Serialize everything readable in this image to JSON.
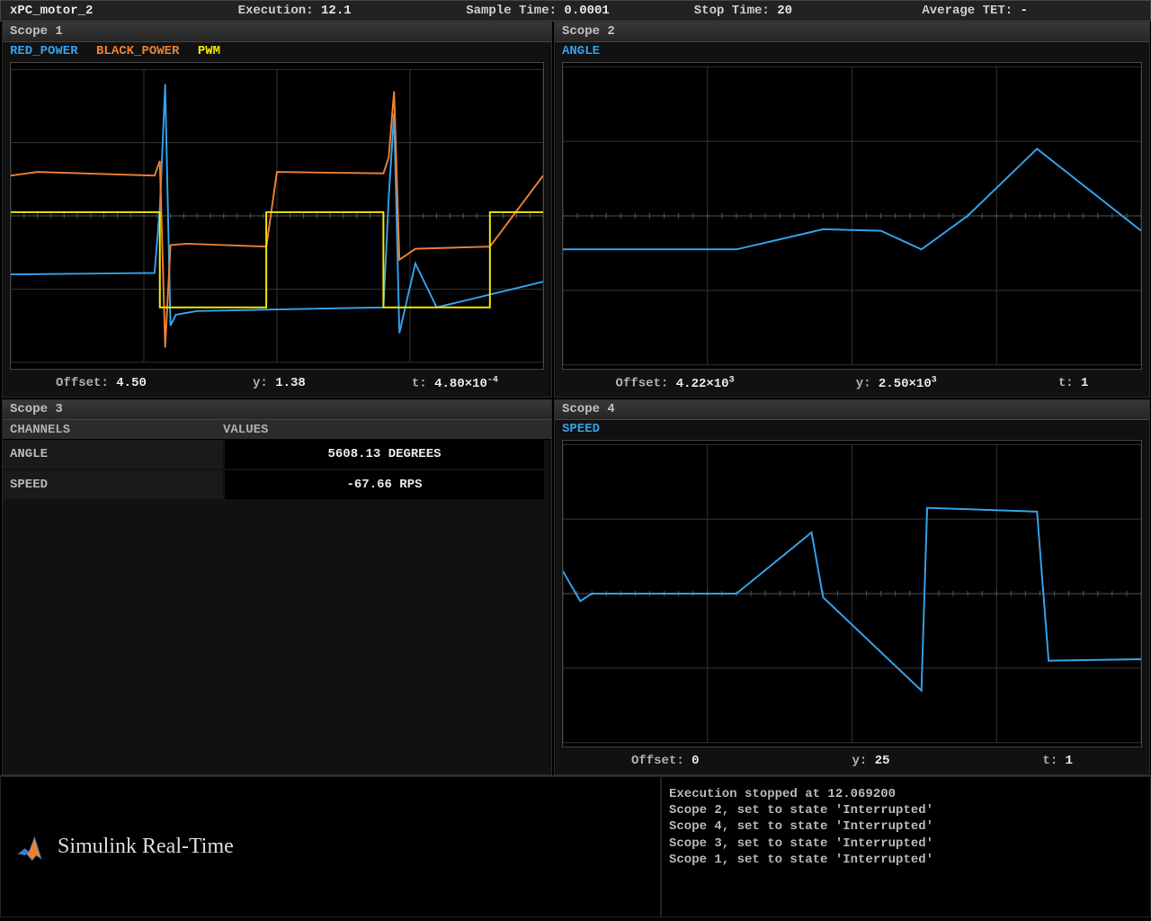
{
  "header": {
    "model_label": "xPC_motor_2",
    "exec_label": "Execution:",
    "exec_val": "12.1",
    "sample_label": "Sample Time:",
    "sample_val": "0.0001",
    "stop_label": "Stop Time:",
    "stop_val": "20",
    "tet_label": "Average TET:",
    "tet_val": "-"
  },
  "scope1": {
    "title": "Scope 1",
    "legend": {
      "a": "RED_POWER",
      "b": "BLACK_POWER",
      "c": "PWM"
    },
    "offset_l": "Offset:",
    "offset_v": "4.50",
    "y_l": "y:",
    "y_v": "1.38",
    "t_l": "t:",
    "t_v_pre": "4.80×10",
    "t_v_exp": "-4"
  },
  "scope2": {
    "title": "Scope 2",
    "legend": {
      "a": "ANGLE"
    },
    "offset_l": "Offset:",
    "offset_v_pre": "4.22×10",
    "offset_v_exp": "3",
    "y_l": "y:",
    "y_v_pre": "2.50×10",
    "y_v_exp": "3",
    "t_l": "t:",
    "t_v": "1"
  },
  "scope3": {
    "title": "Scope 3",
    "head_ch": "CHANNELS",
    "head_val": "VALUES",
    "rows": [
      {
        "ch": "ANGLE",
        "val": "5608.13 DEGREES"
      },
      {
        "ch": "SPEED",
        "val": "-67.66 RPS"
      }
    ]
  },
  "scope4": {
    "title": "Scope 4",
    "legend": {
      "a": "SPEED"
    },
    "offset_l": "Offset:",
    "offset_v": "0",
    "y_l": "y:",
    "y_v": "25",
    "t_l": "t:",
    "t_v": "1"
  },
  "footer": {
    "logo": "Simulink Real-Time",
    "log": [
      "Execution stopped at 12.069200",
      "Scope 2, set to state 'Interrupted'",
      "Scope 4, set to state 'Interrupted'",
      "Scope 3, set to state 'Interrupted'",
      "Scope 1, set to state 'Interrupted'"
    ]
  },
  "chart_data": [
    {
      "scope": "Scope 1",
      "type": "line",
      "x_range_note": "time window ≈ 4.8e-4 s, offset 4.50",
      "y_scale": 1.38,
      "series": [
        {
          "name": "RED_POWER",
          "color": "#33a0e8",
          "x_norm": [
            0,
            0.27,
            0.28,
            0.29,
            0.3,
            0.31,
            0.35,
            0.7,
            0.71,
            0.72,
            0.73,
            0.76,
            0.8,
            1.0
          ],
          "y_norm": [
            -0.8,
            -0.78,
            0.1,
            1.8,
            -1.5,
            -1.35,
            -1.3,
            -1.25,
            0.25,
            1.4,
            -1.6,
            -0.65,
            -1.25,
            -0.9
          ]
        },
        {
          "name": "BLACK_POWER",
          "color": "#e87f33",
          "x_norm": [
            0,
            0.05,
            0.27,
            0.28,
            0.29,
            0.3,
            0.33,
            0.48,
            0.5,
            0.7,
            0.71,
            0.72,
            0.73,
            0.76,
            0.9,
            1.0
          ],
          "y_norm": [
            0.55,
            0.6,
            0.55,
            0.75,
            -1.8,
            -0.4,
            -0.38,
            -0.42,
            0.6,
            0.58,
            0.8,
            1.7,
            -0.6,
            -0.45,
            -0.42,
            0.55
          ]
        },
        {
          "name": "PWM",
          "color": "#f0e800",
          "x_norm": [
            0,
            0.28,
            0.28,
            0.48,
            0.48,
            0.7,
            0.7,
            0.9,
            0.9,
            1.0
          ],
          "y_norm": [
            0.05,
            0.05,
            -1.25,
            -1.25,
            0.05,
            0.05,
            -1.25,
            -1.25,
            0.05,
            0.05
          ]
        }
      ]
    },
    {
      "scope": "Scope 2",
      "type": "line",
      "offset": 4220,
      "y_scale": 2500,
      "t_scale": 1,
      "series": [
        {
          "name": "ANGLE",
          "color": "#33a0e8",
          "x_norm": [
            0,
            0.3,
            0.45,
            0.55,
            0.62,
            0.7,
            0.82,
            1.0
          ],
          "y_norm": [
            -0.45,
            -0.45,
            -0.18,
            -0.2,
            -0.45,
            0.0,
            0.9,
            -0.2
          ]
        }
      ]
    },
    {
      "scope": "Scope 4",
      "type": "line",
      "offset": 0,
      "y_scale": 25,
      "t_scale": 1,
      "series": [
        {
          "name": "SPEED",
          "color": "#33a0e8",
          "x_norm": [
            0,
            0.03,
            0.05,
            0.3,
            0.43,
            0.45,
            0.62,
            0.63,
            0.82,
            0.84,
            1.0
          ],
          "y_norm": [
            0.3,
            -0.1,
            0.0,
            0.0,
            0.82,
            -0.05,
            -1.3,
            1.15,
            1.1,
            -0.9,
            -0.88
          ]
        }
      ]
    }
  ]
}
